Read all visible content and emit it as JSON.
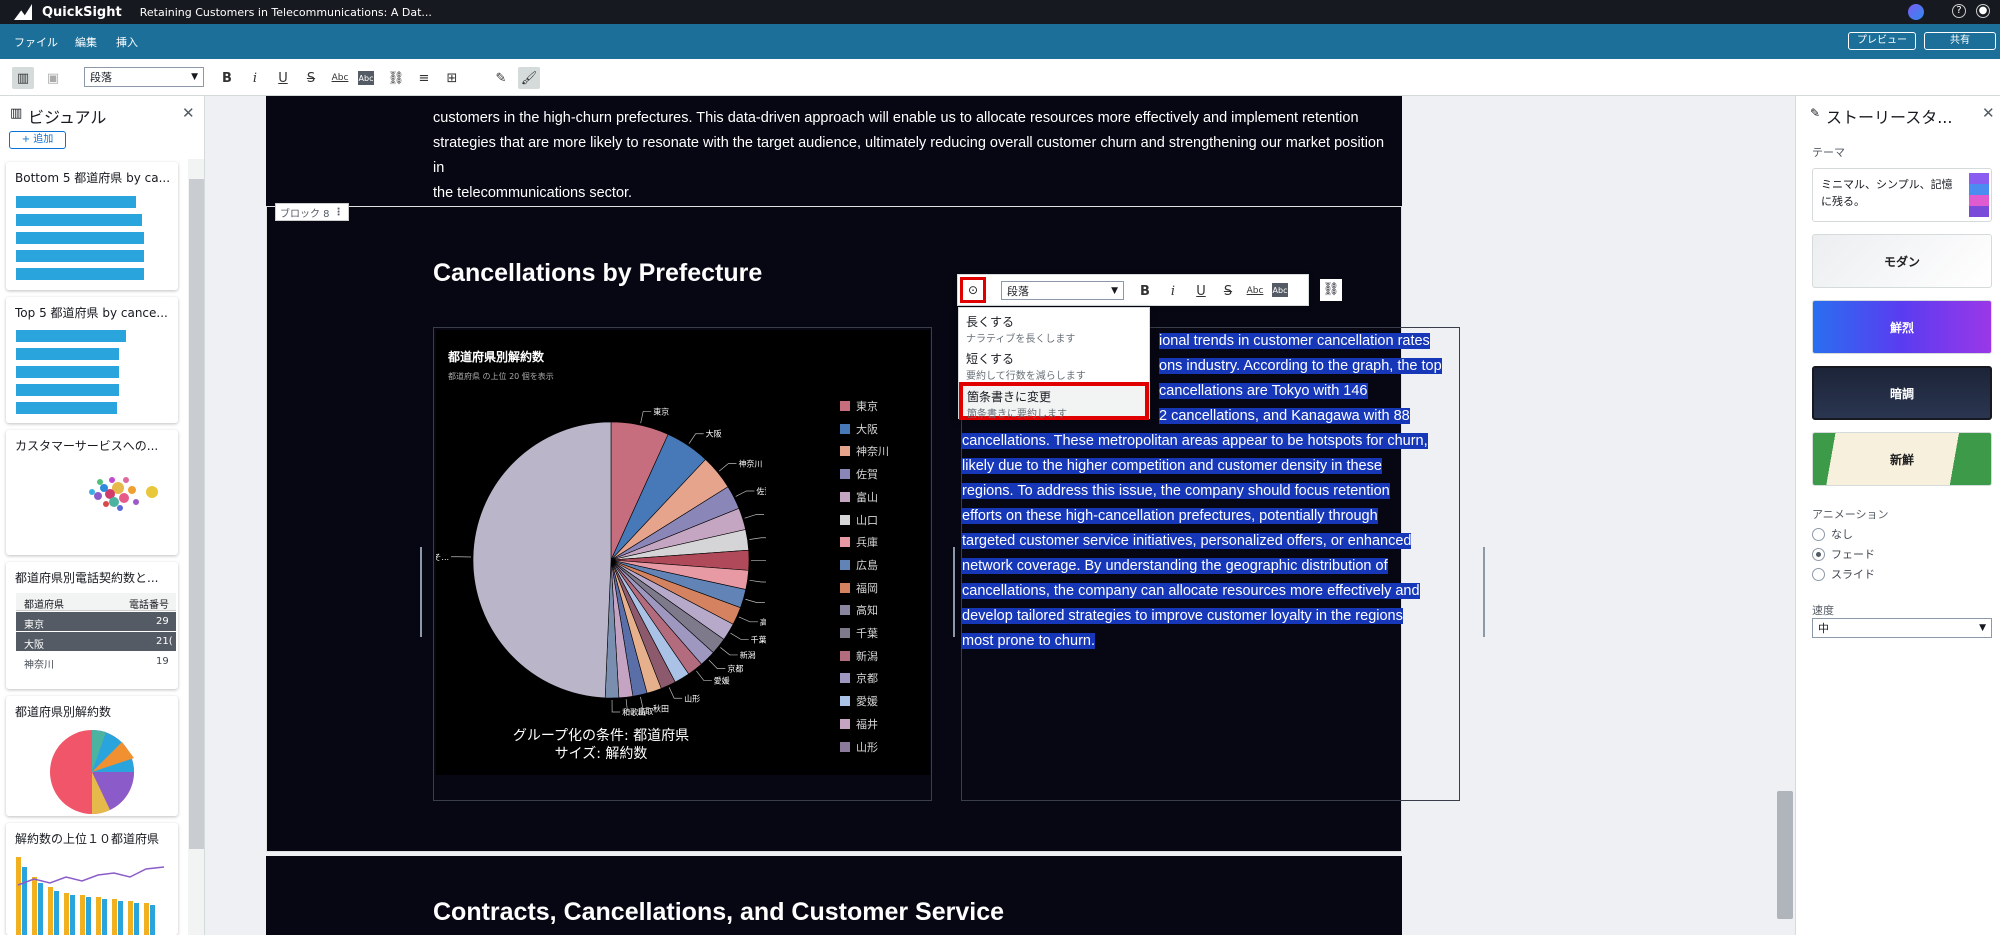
{
  "topbar": {
    "app_name": "QuickSight",
    "doc_title": "Retaining Customers in Telecommunications: A Dat..."
  },
  "menubar": {
    "items": [
      "ファイル",
      "編集",
      "挿入"
    ],
    "preview_label": "プレビュー",
    "share_label": "共有"
  },
  "toolbar": {
    "paragraph_style": "段落"
  },
  "left_panel": {
    "title": "ビジュアル",
    "add_label": "+ 追加",
    "cards": [
      {
        "title": "Bottom 5 都道府県 by ca..."
      },
      {
        "title": "Top 5 都道府県 by cance..."
      },
      {
        "title": "カスタマーサービスへの..."
      },
      {
        "title": "都道府県別電話契約数と...",
        "table_headers": [
          "都道府県",
          "電話番号"
        ],
        "rows": [
          [
            "東京",
            "29"
          ],
          [
            "大阪",
            "21("
          ],
          [
            "神奈川",
            "19"
          ]
        ]
      },
      {
        "title": "都道府県別解約数"
      },
      {
        "title": "解約数の上位１０都道府県"
      }
    ]
  },
  "story": {
    "intro_lines": [
      "customers in the high-churn prefectures. This data-driven approach will enable us to allocate resources more effectively and implement retention",
      "strategies that are more likely to resonate with the target audience, ultimately reducing overall customer churn and strengthening our market position in",
      "the telecommunications sector."
    ],
    "block_label": "ブロック 8",
    "heading": "Cancellations by Prefecture",
    "heading2": "Contracts, Cancellations, and Customer Service",
    "text_lines": [
      "ional trends in customer cancellation rates",
      "ons industry. According to the graph, the top",
      "cancellations are Tokyo with 146",
      "2 cancellations, and Kanagawa with 88",
      "cancellations. These metropolitan areas appear to be hotspots for churn,",
      "likely due to the higher competition and customer density in these",
      "regions. To address this issue, the company should focus retention",
      "efforts on these high-cancellation prefectures, potentially through",
      "targeted customer service initiatives, personalized offers, or enhanced",
      "network coverage. By understanding the geographic distribution of",
      "cancellations, the company can allocate resources more effectively and",
      "develop tailored strategies to improve customer loyalty in the regions",
      "most prone to churn."
    ]
  },
  "text_toolbar": {
    "paragraph_style": "段落"
  },
  "ai_menu": {
    "items": [
      {
        "title": "長くする",
        "sub": "ナラティブを長くします"
      },
      {
        "title": "短くする",
        "sub": "要約して行数を減らします"
      },
      {
        "title": "箇条書きに変更",
        "sub": "箇条書きに要約します"
      }
    ]
  },
  "chart": {
    "title": "都道府県別解約数",
    "subtitle": "都道府県 の上位 20 個を表示",
    "caption_line1": "グループ化の条件: 都道府県",
    "caption_line2": "サイズ: 解約数"
  },
  "chart_data": {
    "type": "pie",
    "title": "都道府県別解約数",
    "subtitle": "都道府県 の上位 20 個を表示",
    "categories": [
      "東京",
      "大阪",
      "神奈川",
      "佐賀",
      "富山",
      "山口",
      "兵庫",
      "広島",
      "福岡",
      "高知",
      "千葉",
      "新潟",
      "京都",
      "愛媛",
      "福井",
      "山形",
      "岩手",
      "秋田",
      "鳥取",
      "和歌山",
      "その他"
    ],
    "values": [
      146,
      112,
      88,
      60,
      55,
      52,
      50,
      48,
      47,
      45,
      44,
      42,
      41,
      40,
      39,
      38,
      37,
      36,
      35,
      34,
      1060
    ],
    "colors": [
      "#c66d7e",
      "#4779b8",
      "#e6a48d",
      "#8b86b8",
      "#c5a6c2",
      "#d5d4d6",
      "#b04a5a",
      "#e89aa4",
      "#6283b5",
      "#d4825f",
      "#b6a9ca",
      "#7e7a8c",
      "#9e97c0",
      "#b36c7e",
      "#aac2e6",
      "#8c5a6c",
      "#e7b08d",
      "#5a6ea8",
      "#c4a4c2",
      "#7a8fb0",
      "#bab5c9"
    ],
    "legend": [
      "東京",
      "大阪",
      "神奈川",
      "佐賀",
      "富山",
      "山口",
      "兵庫",
      "広島",
      "福岡",
      "高知",
      "千葉",
      "新潟",
      "京都",
      "愛媛",
      "福井",
      "山形"
    ],
    "legend_colors": [
      "#c66d7e",
      "#4779b8",
      "#e6a48d",
      "#8b86b8",
      "#c5a6c2",
      "#d5d4d6",
      "#e89aa4",
      "#6283b5",
      "#d4825f",
      "#8b86a0",
      "#7e7a8c",
      "#b36c7e",
      "#9e97c0",
      "#aac2e6",
      "#c4a4c2",
      "#8c7a9a"
    ],
    "slice_labels": [
      "東京",
      "大阪",
      "神奈川",
      "佐賀",
      "富山",
      "山口",
      "兵庫",
      "広島",
      "福岡",
      "高知",
      "千葉",
      "新潟",
      "京都",
      "愛媛",
      "山形",
      "鳥取",
      "秋田",
      "和歌山",
      "そ..."
    ]
  },
  "right_panel": {
    "title": "ストーリースタ...",
    "theme_label": "テーマ",
    "themes": [
      "ミニマル、シンプル、記憶に残る。",
      "モダン",
      "鮮烈",
      "暗調",
      "新鮮"
    ],
    "animation_label": "アニメーション",
    "animations": [
      "なし",
      "フェード",
      "スライド"
    ],
    "speed_label": "速度",
    "speed_value": "中"
  }
}
